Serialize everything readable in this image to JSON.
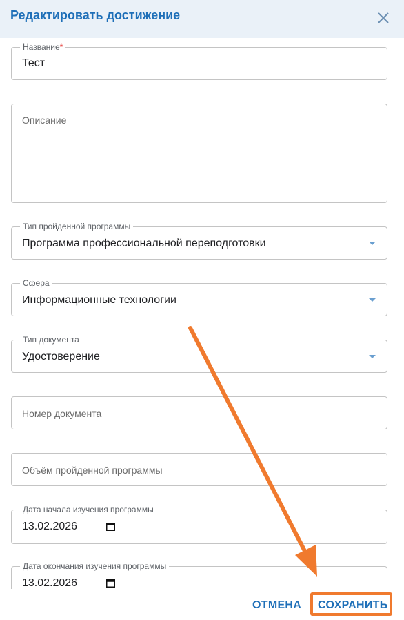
{
  "dialog": {
    "title": "Редактировать достижение",
    "close_icon": "close-icon"
  },
  "fields": {
    "name": {
      "label": "Название",
      "required_mark": "*",
      "value": "Тест"
    },
    "description": {
      "placeholder": "Описание"
    },
    "program_type": {
      "label": "Тип пройденной программы",
      "value": "Программа профессиональной переподготовки"
    },
    "sphere": {
      "label": "Сфера",
      "value": "Информационные технологии"
    },
    "document_type": {
      "label": "Тип документа",
      "value": "Удостоверение"
    },
    "document_number": {
      "placeholder": "Номер документа"
    },
    "program_volume": {
      "placeholder": "Объём пройденной программы"
    },
    "start_date": {
      "label": "Дата начала изучения программы",
      "value": "13.02.2026"
    },
    "end_date": {
      "label": "Дата окончания изучения программы",
      "value": "13.02.2026"
    }
  },
  "footer": {
    "cancel_label": "ОТМЕНА",
    "save_label": "СОХРАНИТЬ"
  },
  "annotation": {
    "arrow_color": "#f07a2e",
    "highlight_color": "#f07a2e"
  },
  "colors": {
    "accent": "#1e6fb8",
    "header_bg": "#eaf1f8"
  }
}
